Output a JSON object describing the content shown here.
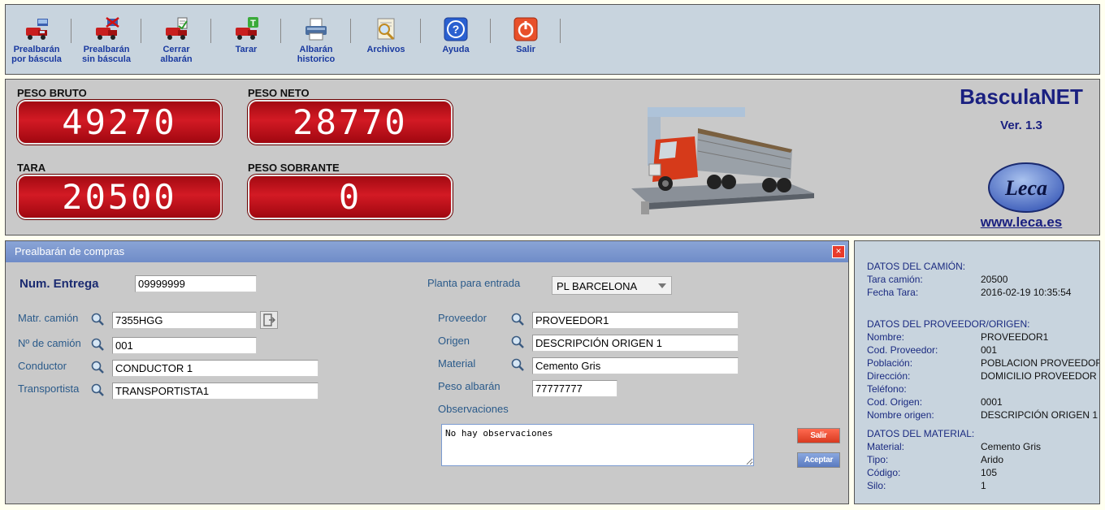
{
  "toolbar": {
    "items": [
      {
        "label1": "Prealbarán",
        "label2": "por báscula"
      },
      {
        "label1": "Prealbarán",
        "label2": "sin báscula"
      },
      {
        "label1": "Cerrar",
        "label2": "albarán"
      },
      {
        "label1": "Tarar",
        "label2": ""
      },
      {
        "label1": "Albarán",
        "label2": "historico"
      },
      {
        "label1": "Archivos",
        "label2": ""
      },
      {
        "label1": "Ayuda",
        "label2": ""
      },
      {
        "label1": "Salir",
        "label2": ""
      }
    ]
  },
  "weights": {
    "peso_bruto_label": "PESO BRUTO",
    "peso_bruto": "49270",
    "peso_neto_label": "PESO NETO",
    "peso_neto": "28770",
    "tara_label": "TARA",
    "tara": "20500",
    "peso_sobrante_label": "PESO SOBRANTE",
    "peso_sobrante": "0"
  },
  "brand": {
    "title": "BasculaNET",
    "version": "Ver. 1.3",
    "logo_text": "Leca",
    "url": "www.leca.es"
  },
  "form": {
    "title": "Prealbarán de compras",
    "close": "×",
    "num_entrega_label": "Num. Entrega",
    "num_entrega": "09999999",
    "planta_label": "Planta para entrada",
    "planta_value": "PL BARCELONA",
    "matricula_label": "Matr. camión",
    "matricula": "7355HGG",
    "num_camion_label": "Nº de camión",
    "num_camion": "001",
    "conductor_label": "Conductor",
    "conductor": "CONDUCTOR 1",
    "transportista_label": "Transportista",
    "transportista": "TRANSPORTISTA1",
    "proveedor_label": "Proveedor",
    "proveedor": "PROVEEDOR1",
    "origen_label": "Origen",
    "origen": "DESCRIPCIÓN ORIGEN 1",
    "material_label": "Material",
    "material": "Cemento Gris",
    "peso_albaran_label": "Peso albarán",
    "peso_albaran": "77777777",
    "observaciones_label": "Observaciones",
    "observaciones": "No hay observaciones",
    "salir": "Salir",
    "aceptar": "Aceptar"
  },
  "info": {
    "camion_header": "DATOS DEL CAMIÓN:",
    "tara_camion_label": "Tara camión:",
    "tara_camion": "20500",
    "fecha_tara_label": "Fecha Tara:",
    "fecha_tara": "2016-02-19 10:35:54",
    "proveedor_header": "DATOS DEL PROVEEDOR/ORIGEN:",
    "nombre_label": "Nombre:",
    "nombre": "PROVEEDOR1",
    "cod_proveedor_label": "Cod. Proveedor:",
    "cod_proveedor": "001",
    "poblacion_label": "Población:",
    "poblacion": "POBLACION PROVEEDOR",
    "direccion_label": "Dirección:",
    "direccion": "DOMICILIO PROVEEDOR",
    "telefono_label": "Teléfono:",
    "cod_origen_label": "Cod. Origen:",
    "cod_origen": "0001",
    "nombre_origen_label": "Nombre origen:",
    "nombre_origen": "DESCRIPCIÓN ORIGEN 1",
    "material_header": "DATOS DEL MATERIAL:",
    "material_label": "Material:",
    "material": "Cemento Gris",
    "tipo_label": "Tipo:",
    "tipo": "Arido",
    "codigo_label": "Código:",
    "codigo": "105",
    "silo_label": "Silo:",
    "silo": "1"
  },
  "colors": {
    "accent": "#1a2080",
    "display_red": "#c0121c",
    "salir_red": "#e03a28",
    "aceptar_blue": "#6f8cc8"
  }
}
